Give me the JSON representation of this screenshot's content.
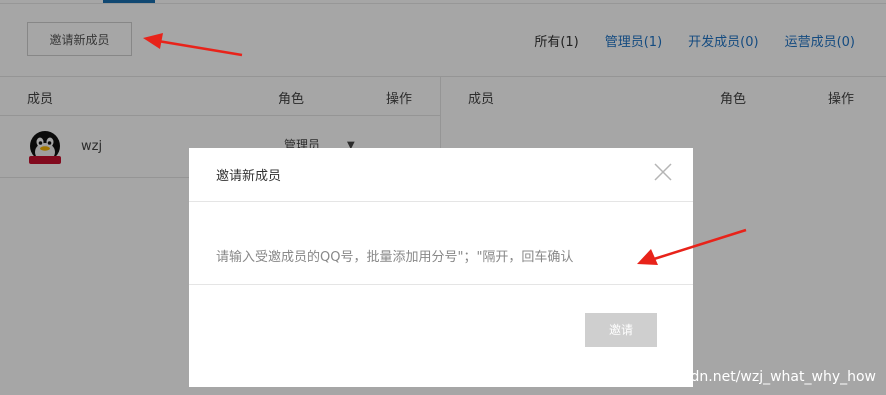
{
  "toolbar": {
    "invite_label": "邀请新成员"
  },
  "filters": [
    {
      "label": "所有(1)",
      "active": true
    },
    {
      "label": "管理员(1)",
      "active": false
    },
    {
      "label": "开发成员(0)",
      "active": false
    },
    {
      "label": "运营成员(0)",
      "active": false
    }
  ],
  "table": {
    "left_headers": {
      "member": "成员",
      "role": "角色",
      "action": "操作"
    },
    "right_headers": {
      "member": "成员",
      "role": "角色",
      "action": "操作"
    },
    "rows": [
      {
        "name": "wzj",
        "role": "管理员"
      }
    ]
  },
  "modal": {
    "title": "邀请新成员",
    "input_placeholder": "请输入受邀成员的QQ号，批量添加用分号\"；\"隔开，回车确认",
    "confirm_label": "邀请"
  },
  "watermark": "https://blog.csdn.net/wzj_what_why_how",
  "colors": {
    "link": "#1f73c5",
    "annotation_arrow": "#e8231a",
    "disabled_button": "#cfcfcf",
    "overlay": "rgba(0,0,0,0.35)"
  }
}
